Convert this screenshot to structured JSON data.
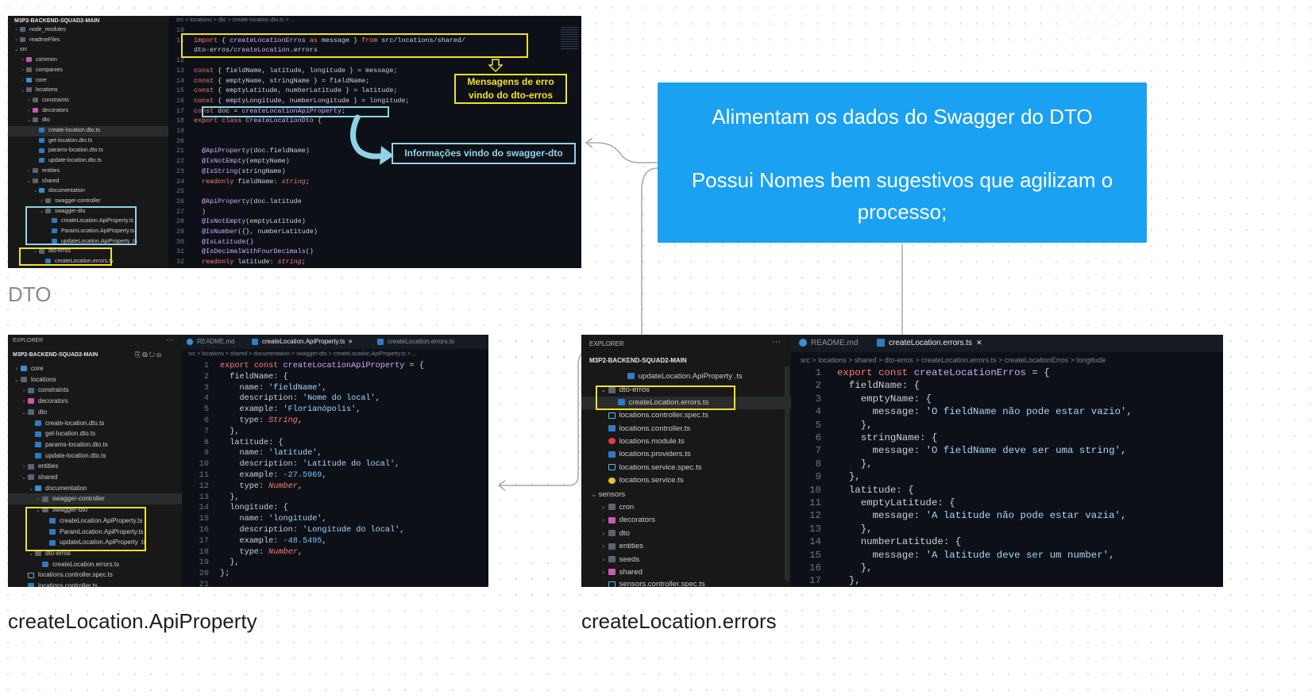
{
  "note": {
    "line1": "Alimentam os dados do Swagger do DTO",
    "line2": "Possui Nomes bem sugestivos que agilizam o",
    "line3": "processo;"
  },
  "captions": {
    "dto": "DTO",
    "api": "createLocation.ApiProperty",
    "errors": "createLocation.errors"
  },
  "shot1": {
    "root": "M3P2-BACKEND-SQUAD2-MAIN",
    "breadcrumb": "src > locations > dto > create-location.dto.ts > ...",
    "tree": [
      {
        "label": "node_modules",
        "icon": "folder",
        "depth": 0
      },
      {
        "label": "readmeFiles",
        "icon": "folder",
        "depth": 0
      },
      {
        "label": "src",
        "icon": "none",
        "depth": 0,
        "open": true
      },
      {
        "label": "common",
        "icon": "folder-pink",
        "depth": 1
      },
      {
        "label": "companies",
        "icon": "folder",
        "depth": 1
      },
      {
        "label": "core",
        "icon": "folder-blue",
        "depth": 1
      },
      {
        "label": "locations",
        "icon": "folder",
        "depth": 1,
        "open": true
      },
      {
        "label": "constraints",
        "icon": "folder",
        "depth": 2
      },
      {
        "label": "decorators",
        "icon": "folder-pink",
        "depth": 2
      },
      {
        "label": "dto",
        "icon": "folder",
        "depth": 2,
        "open": true
      },
      {
        "label": "create-location.dto.ts",
        "icon": "ts",
        "depth": 3,
        "selected": true
      },
      {
        "label": "get-location.dto.ts",
        "icon": "ts",
        "depth": 3
      },
      {
        "label": "params-location.dto.ts",
        "icon": "ts",
        "depth": 3
      },
      {
        "label": "update-location.dto.ts",
        "icon": "ts",
        "depth": 3
      },
      {
        "label": "entities",
        "icon": "folder",
        "depth": 2
      },
      {
        "label": "shared",
        "icon": "folder",
        "depth": 2,
        "open": true
      },
      {
        "label": "documentation",
        "icon": "folder-blue",
        "depth": 3,
        "open": true
      },
      {
        "label": "swagger-controller",
        "icon": "folder",
        "depth": 4
      },
      {
        "label": "swagger-dto",
        "icon": "folder",
        "depth": 4,
        "open": true
      },
      {
        "label": "createLocation.ApiProperty.ts",
        "icon": "ts",
        "depth": 5
      },
      {
        "label": "ParamLocation.ApiProperty.ts",
        "icon": "ts",
        "depth": 5
      },
      {
        "label": "updateLocation.ApiProperty .ts",
        "icon": "ts",
        "depth": 5
      },
      {
        "label": "dto-erros",
        "icon": "folder",
        "depth": 3,
        "open": true
      },
      {
        "label": "createLocation.errors.ts",
        "icon": "ts",
        "depth": 4
      }
    ],
    "code": [
      {
        "n": "10",
        "t": ""
      },
      {
        "n": "11",
        "t": "import { createLocationErros as message } from 'src/locations/shared/"
      },
      {
        "n": "",
        "t": "dto-erros/createLocation.errors'"
      },
      {
        "n": "12",
        "t": ""
      },
      {
        "n": "13",
        "t": "const { fieldName, latitude, longitude } = message;"
      },
      {
        "n": "14",
        "t": "const { emptyName, stringName } = fieldName;"
      },
      {
        "n": "15",
        "t": "const { emptyLatitude, numberLatitude } = latitude;"
      },
      {
        "n": "16",
        "t": "const { emptyLongitude, numberLongitude } = longitude;"
      },
      {
        "n": "17",
        "t": "const doc = createLocationApiProperty;"
      },
      {
        "n": "18",
        "t": "export class CreateLocationDto {"
      },
      {
        "n": "19",
        "t": ""
      },
      {
        "n": "20",
        "t": ""
      },
      {
        "n": "21",
        "t": "  @ApiProperty(doc.fieldName)"
      },
      {
        "n": "22",
        "t": "  @IsNotEmpty(emptyName)"
      },
      {
        "n": "23",
        "t": "  @IsString(stringName)"
      },
      {
        "n": "24",
        "t": "  readonly fieldName: string;"
      },
      {
        "n": "25",
        "t": ""
      },
      {
        "n": "26",
        "t": "  @ApiProperty(doc.latitude"
      },
      {
        "n": "27",
        "t": "  )"
      },
      {
        "n": "28",
        "t": "  @IsNotEmpty(emptyLatitude)"
      },
      {
        "n": "29",
        "t": "  @IsNumber({}, numberLatitude)"
      },
      {
        "n": "30",
        "t": "  @IsLatitude()"
      },
      {
        "n": "31",
        "t": "  @IsDecimalWithFourDecimals()"
      },
      {
        "n": "32",
        "t": "  readonly latitude: string;"
      }
    ],
    "callout_errors_1": "Mensagens de erro",
    "callout_errors_2": "vindo do dto-erros",
    "callout_swagger": "Informações vindo do swagger-dto"
  },
  "shot2": {
    "explorer": "EXPLORER",
    "root": "M3P2-BACKEND-SQUAD2-MAIN",
    "tabs": [
      "README.md",
      "createLocation.ApiProperty.ts",
      "createLocation.errors.ts"
    ],
    "breadcrumb": "src > locations > shared > documentation > swagger-dto > createLocation.ApiProperty.ts > ...",
    "tree": [
      {
        "label": "core",
        "icon": "folder-blue",
        "depth": 0
      },
      {
        "label": "locations",
        "icon": "folder",
        "depth": 0,
        "open": true
      },
      {
        "label": "constraints",
        "icon": "folder",
        "depth": 1
      },
      {
        "label": "decorators",
        "icon": "folder-pink",
        "depth": 1
      },
      {
        "label": "dto",
        "icon": "folder",
        "depth": 1,
        "open": true
      },
      {
        "label": "create-location.dto.ts",
        "icon": "ts",
        "depth": 2
      },
      {
        "label": "get-location.dto.ts",
        "icon": "ts",
        "depth": 2
      },
      {
        "label": "params-location.dto.ts",
        "icon": "ts",
        "depth": 2
      },
      {
        "label": "update-location.dto.ts",
        "icon": "ts",
        "depth": 2
      },
      {
        "label": "entities",
        "icon": "folder",
        "depth": 1
      },
      {
        "label": "shared",
        "icon": "folder",
        "depth": 1,
        "open": true
      },
      {
        "label": "documentation",
        "icon": "folder-blue",
        "depth": 2,
        "open": true
      },
      {
        "label": "swagger-controller",
        "icon": "folder",
        "depth": 3,
        "selected": true
      },
      {
        "label": "swagger-dto",
        "icon": "folder",
        "depth": 3,
        "open": true
      },
      {
        "label": "createLocation.ApiProperty.ts",
        "icon": "ts",
        "depth": 4
      },
      {
        "label": "ParamLocation.ApiProperty.ts",
        "icon": "ts",
        "depth": 4
      },
      {
        "label": "updateLocation.ApiProperty .ts",
        "icon": "ts",
        "depth": 4
      },
      {
        "label": "dto-erros",
        "icon": "folder",
        "depth": 2,
        "open": true
      },
      {
        "label": "createLocation.errors.ts",
        "icon": "ts",
        "depth": 3
      },
      {
        "label": "locations.controller.spec.ts",
        "icon": "spec",
        "depth": 1
      },
      {
        "label": "locations.controller.ts",
        "icon": "ts",
        "depth": 1
      }
    ],
    "code": [
      {
        "n": "1",
        "t": "export const createLocationApiProperty = {"
      },
      {
        "n": "2",
        "t": "  fieldName: {"
      },
      {
        "n": "3",
        "t": "    name: 'fieldName',"
      },
      {
        "n": "4",
        "t": "    description: 'Nome do local',"
      },
      {
        "n": "5",
        "t": "    example: 'Florianópolis',"
      },
      {
        "n": "6",
        "t": "    type: String,"
      },
      {
        "n": "7",
        "t": "  },"
      },
      {
        "n": "8",
        "t": "  latitude: {"
      },
      {
        "n": "9",
        "t": "    name: 'latitude',"
      },
      {
        "n": "10",
        "t": "    description: 'Latitude do local',"
      },
      {
        "n": "11",
        "t": "    example: -27.5969,"
      },
      {
        "n": "12",
        "t": "    type: Number,"
      },
      {
        "n": "13",
        "t": "  },"
      },
      {
        "n": "14",
        "t": "  longitude: {"
      },
      {
        "n": "15",
        "t": "    name: 'longitude',"
      },
      {
        "n": "16",
        "t": "    description: 'Longitude do local',"
      },
      {
        "n": "17",
        "t": "    example: -48.5495,"
      },
      {
        "n": "18",
        "t": "    type: Number,"
      },
      {
        "n": "19",
        "t": "  },"
      },
      {
        "n": "20",
        "t": "};"
      },
      {
        "n": "21",
        "t": ""
      }
    ]
  },
  "shot3": {
    "explorer": "EXPLORER",
    "root": "M3P2-BACKEND-SQUAD2-MAIN",
    "tabs": [
      "README.md",
      "createLocation.errors.ts"
    ],
    "breadcrumb": "src > locations > shared > dto-erros > createLocation.errors.ts > createLocationErros > longitude",
    "tree": [
      {
        "label": "updateLocation.ApiProperty .ts",
        "icon": "ts",
        "depth": 3
      },
      {
        "label": "dto-erros",
        "icon": "folder",
        "depth": 1,
        "open": true
      },
      {
        "label": "createLocation.errors.ts",
        "icon": "ts",
        "depth": 2,
        "selected": true
      },
      {
        "label": "locations.controller.spec.ts",
        "icon": "spec",
        "depth": 1
      },
      {
        "label": "locations.controller.ts",
        "icon": "ts",
        "depth": 1
      },
      {
        "label": "locations.module.ts",
        "icon": "mod",
        "depth": 1
      },
      {
        "label": "locations.providers.ts",
        "icon": "ts",
        "depth": 1
      },
      {
        "label": "locations.service.spec.ts",
        "icon": "spec",
        "depth": 1
      },
      {
        "label": "locations.service.ts",
        "icon": "svc",
        "depth": 1
      },
      {
        "label": "sensors",
        "icon": "none",
        "depth": 0,
        "open": true
      },
      {
        "label": "cron",
        "icon": "folder",
        "depth": 1
      },
      {
        "label": "decorators",
        "icon": "folder-pink",
        "depth": 1
      },
      {
        "label": "dto",
        "icon": "folder",
        "depth": 1
      },
      {
        "label": "entities",
        "icon": "folder",
        "depth": 1
      },
      {
        "label": "seeds",
        "icon": "folder",
        "depth": 1
      },
      {
        "label": "shared",
        "icon": "folder-pink",
        "depth": 1
      },
      {
        "label": "sensors.controller.spec.ts",
        "icon": "spec",
        "depth": 1
      }
    ],
    "code": [
      {
        "n": "1",
        "t": "export const createLocationErros = {"
      },
      {
        "n": "2",
        "t": "  fieldName: {"
      },
      {
        "n": "3",
        "t": "    emptyName: {"
      },
      {
        "n": "4",
        "t": "      message: 'O fieldName não pode estar vazio',"
      },
      {
        "n": "5",
        "t": "    },"
      },
      {
        "n": "6",
        "t": "    stringName: {"
      },
      {
        "n": "7",
        "t": "      message: 'O fieldName deve ser uma string',"
      },
      {
        "n": "8",
        "t": "    },"
      },
      {
        "n": "9",
        "t": "  },"
      },
      {
        "n": "10",
        "t": "  latitude: {"
      },
      {
        "n": "11",
        "t": "    emptyLatitude: {"
      },
      {
        "n": "12",
        "t": "      message: 'A latitude não pode estar vazia',"
      },
      {
        "n": "13",
        "t": "    },"
      },
      {
        "n": "14",
        "t": "    numberLatitude: {"
      },
      {
        "n": "15",
        "t": "      message: 'A latitude deve ser um number',"
      },
      {
        "n": "16",
        "t": "    },"
      },
      {
        "n": "17",
        "t": "  },"
      }
    ]
  }
}
